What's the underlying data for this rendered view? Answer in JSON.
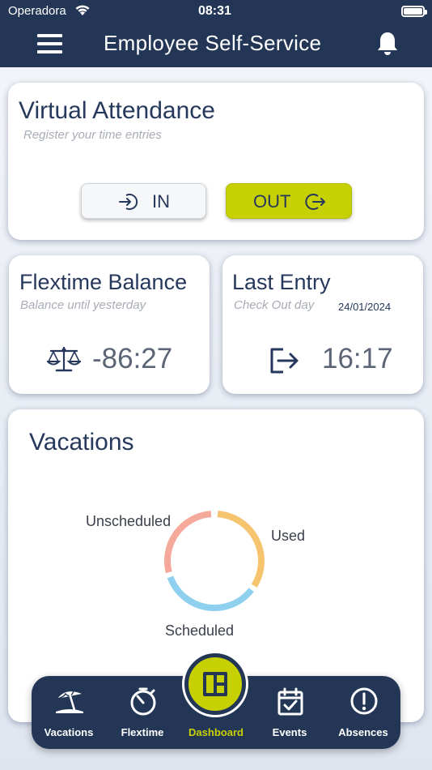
{
  "status_bar": {
    "carrier": "Operadora",
    "time": "08:31"
  },
  "header": {
    "title": "Employee Self-Service",
    "menu_icon": "menu-icon",
    "bell_icon": "bell-icon"
  },
  "attendance": {
    "title": "Virtual Attendance",
    "subtitle": "Register your time entries",
    "in_label": "IN",
    "out_label": "OUT",
    "accent": "#c7d003"
  },
  "flextime": {
    "title": "Flextime Balance",
    "subtitle": "Balance until yesterday",
    "value": "-86:27",
    "icon": "balance-scale-icon"
  },
  "last_entry": {
    "title": "Last Entry",
    "subtitle": "Check Out day",
    "date": "24/01/2024",
    "value": "16:17",
    "icon": "sign-out-icon"
  },
  "vacations": {
    "title": "Vacations",
    "labels": {
      "unscheduled": "Unscheduled",
      "used": "Used",
      "scheduled": "Scheduled"
    },
    "colors": {
      "unscheduled": "#f5a99a",
      "used": "#f6c46f",
      "scheduled": "#8fd0ef"
    }
  },
  "nav": {
    "items": [
      {
        "label": "Vacations",
        "icon": "beach-umbrella-icon"
      },
      {
        "label": "Flextime",
        "icon": "stopwatch-icon"
      },
      {
        "label": "Dashboard",
        "icon": "dashboard-icon",
        "active": true
      },
      {
        "label": "Events",
        "icon": "calendar-check-icon"
      },
      {
        "label": "Absences",
        "icon": "alert-circle-icon"
      }
    ]
  },
  "colors": {
    "navy": "#243656",
    "accent": "#c7d003"
  }
}
